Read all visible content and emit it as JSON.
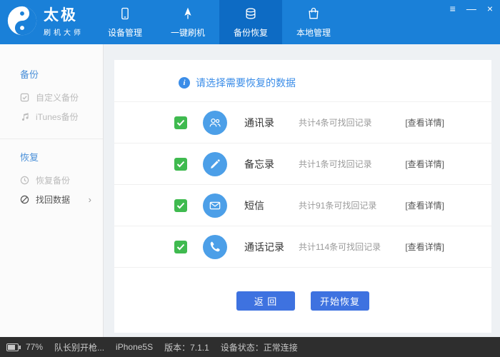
{
  "colors": {
    "header_blue": "#1a80d8",
    "active_tab_blue": "#0d6bc4",
    "accent_blue": "#3b8de8",
    "button_blue": "#3e72e0",
    "checkbox_green": "#3fba4f",
    "row_icon_blue": "#4c9fe8",
    "statusbar_bg": "#2e2e2e"
  },
  "window": {
    "logo_title": "太极",
    "logo_subtitle": "刷机大师",
    "controls": {
      "menu": "≡",
      "minimize": "—",
      "close": "×"
    }
  },
  "nav": {
    "tabs": [
      {
        "label": "设备管理"
      },
      {
        "label": "一键刷机"
      },
      {
        "label": "备份恢复"
      },
      {
        "label": "本地管理"
      }
    ]
  },
  "sidebar": {
    "backup_section": {
      "title": "备份",
      "items": [
        {
          "label": "自定义备份"
        },
        {
          "label": "iTunes备份"
        }
      ]
    },
    "restore_section": {
      "title": "恢复",
      "items": [
        {
          "label": "恢复备份"
        },
        {
          "label": "找回数据",
          "chevron": "›"
        }
      ]
    }
  },
  "main": {
    "header": "请选择需要恢复的数据",
    "info_glyph": "i",
    "rows": [
      {
        "label": "通讯录",
        "detail": "共计4条可找回记录",
        "action": "[查看详情]",
        "checked": true
      },
      {
        "label": "备忘录",
        "detail": "共计1条可找回记录",
        "action": "[查看详情]",
        "checked": true
      },
      {
        "label": "短信",
        "detail": "共计91条可找回记录",
        "action": "[查看详情]",
        "checked": true
      },
      {
        "label": "通话记录",
        "detail": "共计114条可找回记录",
        "action": "[查看详情]",
        "checked": true
      }
    ],
    "buttons": {
      "back": "返 回",
      "start": "开始恢复"
    }
  },
  "statusbar": {
    "battery_percent": "77%",
    "notice": "队长别开枪...",
    "device": "iPhone5S",
    "version": "版本：7.1.1",
    "device_status": "设备状态：正常连接"
  }
}
